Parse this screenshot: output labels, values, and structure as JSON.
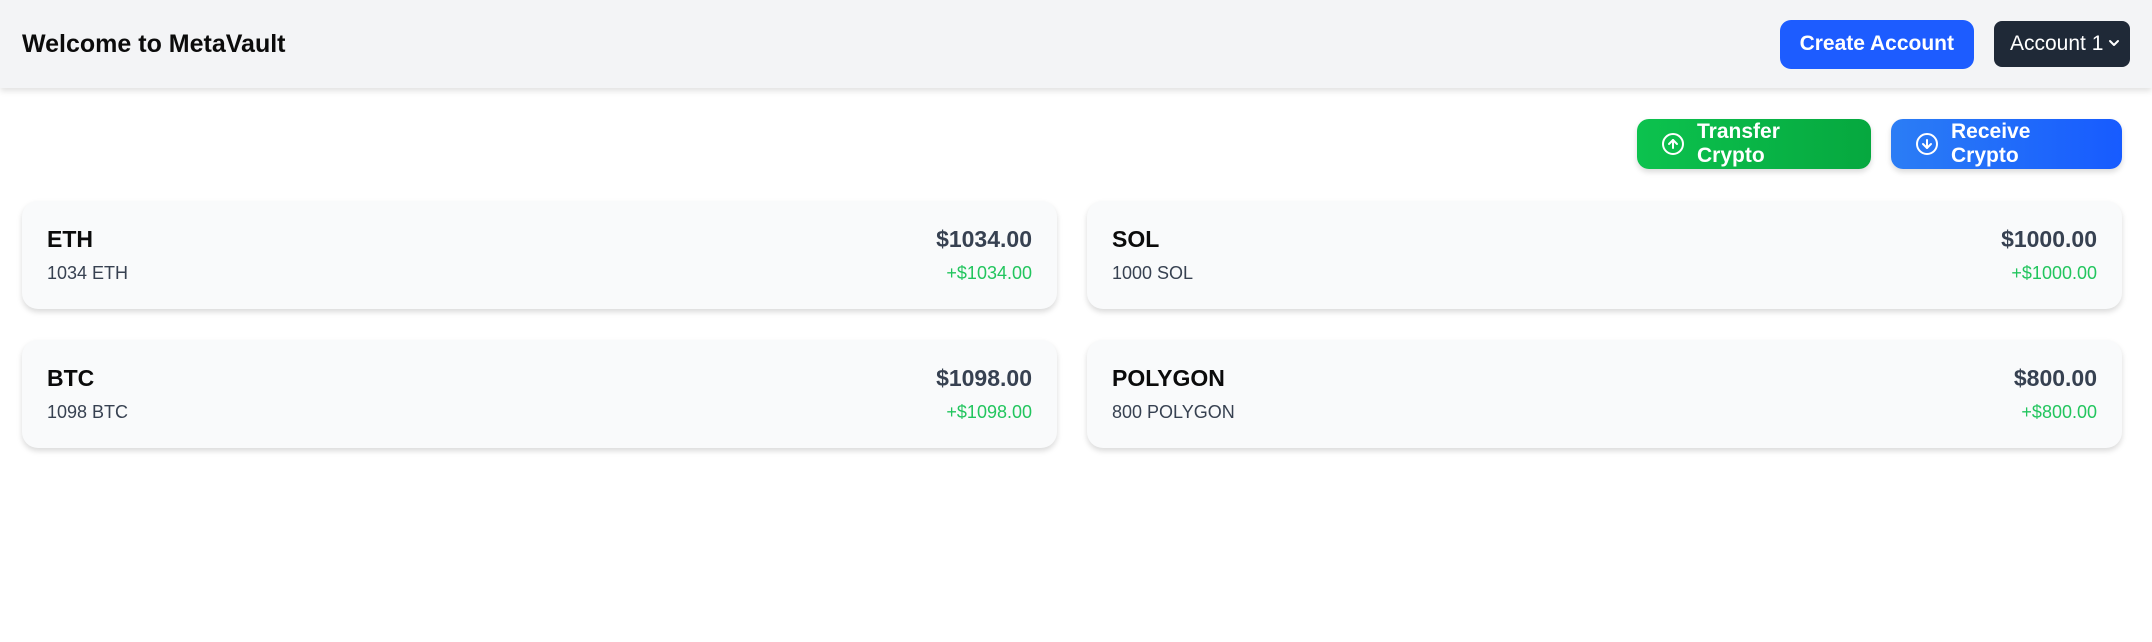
{
  "header": {
    "title": "Welcome to MetaVault",
    "create_account_label": "Create Account",
    "account_selected": "Account 1"
  },
  "actions": {
    "transfer_label": "Transfer Crypto",
    "receive_label": "Receive Crypto"
  },
  "assets": [
    {
      "symbol": "ETH",
      "amount": "1034 ETH",
      "value": "$1034.00",
      "change": "+$1034.00"
    },
    {
      "symbol": "SOL",
      "amount": "1000 SOL",
      "value": "$1000.00",
      "change": "+$1000.00"
    },
    {
      "symbol": "BTC",
      "amount": "1098 BTC",
      "value": "$1098.00",
      "change": "+$1098.00"
    },
    {
      "symbol": "POLYGON",
      "amount": "800 POLYGON",
      "value": "$800.00",
      "change": "+$800.00"
    }
  ],
  "icons": {
    "transfer": "arrow-up-circle-icon",
    "receive": "arrow-down-circle-icon",
    "account_dropdown": "chevron-down-icon"
  },
  "colors": {
    "primary": "#1d5cff",
    "transfer": "#06a83f",
    "receive": "#175bff",
    "positive": "#22c55e",
    "header_bg": "#f3f4f6",
    "select_bg": "#1f2937"
  }
}
